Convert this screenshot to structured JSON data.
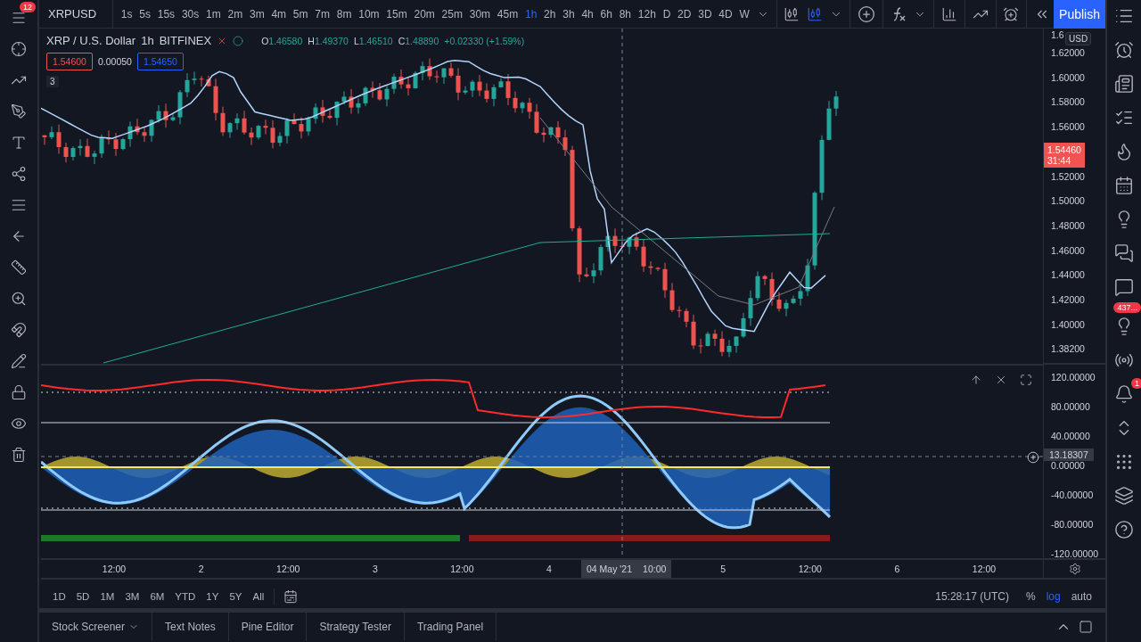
{
  "left_toolbar": {
    "notification_count": "12"
  },
  "toolbar": {
    "symbol": "XRPUSD",
    "intervals": [
      {
        "label": "1s",
        "selected": false
      },
      {
        "label": "5s",
        "selected": false
      },
      {
        "label": "15s",
        "selected": false
      },
      {
        "label": "30s",
        "selected": false
      },
      {
        "label": "1m",
        "selected": false
      },
      {
        "label": "2m",
        "selected": false
      },
      {
        "label": "3m",
        "selected": false
      },
      {
        "label": "4m",
        "selected": false
      },
      {
        "label": "5m",
        "selected": false
      },
      {
        "label": "7m",
        "selected": false
      },
      {
        "label": "8m",
        "selected": false
      },
      {
        "label": "10m",
        "selected": false
      },
      {
        "label": "15m",
        "selected": false
      },
      {
        "label": "20m",
        "selected": false
      },
      {
        "label": "25m",
        "selected": false
      },
      {
        "label": "30m",
        "selected": false
      },
      {
        "label": "45m",
        "selected": false
      },
      {
        "label": "1h",
        "selected": true
      },
      {
        "label": "2h",
        "selected": false
      },
      {
        "label": "3h",
        "selected": false
      },
      {
        "label": "4h",
        "selected": false
      },
      {
        "label": "6h",
        "selected": false
      },
      {
        "label": "8h",
        "selected": false
      },
      {
        "label": "12h",
        "selected": false
      },
      {
        "label": "D",
        "selected": false
      },
      {
        "label": "2D",
        "selected": false
      },
      {
        "label": "3D",
        "selected": false
      },
      {
        "label": "4D",
        "selected": false
      },
      {
        "label": "W",
        "selected": false
      }
    ],
    "publish": "Publish"
  },
  "legend": {
    "title": "XRP / U.S. Dollar",
    "interval": "1h",
    "exchange": "BITFINEX",
    "ohlc": [
      {
        "key": "O",
        "value": "1.46580"
      },
      {
        "key": "H",
        "value": "1.49370"
      },
      {
        "key": "L",
        "value": "1.46510"
      },
      {
        "key": "C",
        "value": "1.48890"
      }
    ],
    "change": "+0.02330 (+1.59%)",
    "sell_price": "1.54600",
    "spread": "0.00050",
    "buy_price": "1.54650",
    "indicator_count": "3"
  },
  "price_axis": {
    "currency": "USD",
    "ticks": [
      "1.6",
      "1.62000",
      "1.60000",
      "1.58000",
      "1.56000",
      "1.52000",
      "1.50000",
      "1.48000",
      "1.46000",
      "1.44000",
      "1.42000",
      "1.40000",
      "1.38200"
    ],
    "last_price": "1.54460",
    "countdown": "31:44"
  },
  "oscillator_axis": {
    "ticks": [
      "120.00000",
      "80.00000",
      "40.00000",
      "0.00000",
      "-40.00000",
      "-80.00000",
      "-120.00000"
    ],
    "crosshair_value": "13.18307"
  },
  "time_axis": {
    "labels": [
      "12:00",
      "2",
      "12:00",
      "3",
      "12:00",
      "4",
      "5",
      "12:00",
      "6",
      "12:00"
    ],
    "crosshair_date": "04 May '21",
    "crosshair_time": "10:00"
  },
  "range_bar": {
    "ranges": [
      "1D",
      "5D",
      "1M",
      "3M",
      "6M",
      "YTD",
      "1Y",
      "5Y",
      "All"
    ],
    "clock": "15:28:17 (UTC)",
    "scale_options": [
      {
        "label": "%",
        "selected": false
      },
      {
        "label": "log",
        "selected": true
      },
      {
        "label": "auto",
        "selected": false
      }
    ]
  },
  "bottom_tabs": [
    "Stock Screener",
    "Text Notes",
    "Pine Editor",
    "Strategy Tester",
    "Trading Panel"
  ],
  "right_sidebar": {
    "ideas_count": "437...",
    "alerts_count": "1"
  }
}
